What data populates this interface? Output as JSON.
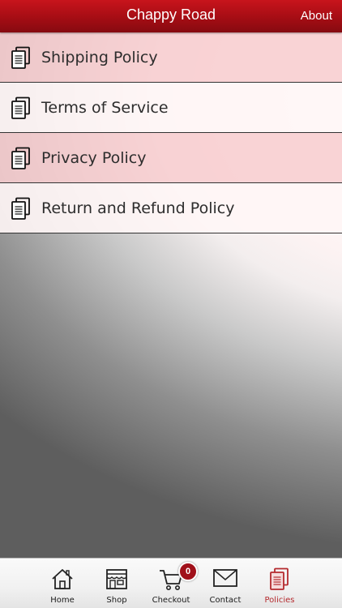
{
  "header": {
    "title": "Chappy Road",
    "about_label": "About"
  },
  "policies": [
    {
      "label": "Shipping Policy",
      "icon": "document-icon"
    },
    {
      "label": "Terms of Service",
      "icon": "document-icon"
    },
    {
      "label": "Privacy Policy",
      "icon": "document-icon"
    },
    {
      "label": "Return and Refund Policy",
      "icon": "document-icon"
    }
  ],
  "tabbar": {
    "tabs": [
      {
        "label": "Home",
        "icon": "home-icon"
      },
      {
        "label": "Shop",
        "icon": "shop-icon"
      },
      {
        "label": "Checkout",
        "icon": "cart-icon"
      },
      {
        "label": "Contact",
        "icon": "mail-icon"
      },
      {
        "label": "Policies",
        "icon": "document-icon",
        "active": true
      }
    ],
    "cart_count": "0"
  },
  "colors": {
    "header": "#a50d14",
    "active_tab": "#b52a2e",
    "row_shaded": "#f8cdcf",
    "badge": "#a0101a"
  }
}
